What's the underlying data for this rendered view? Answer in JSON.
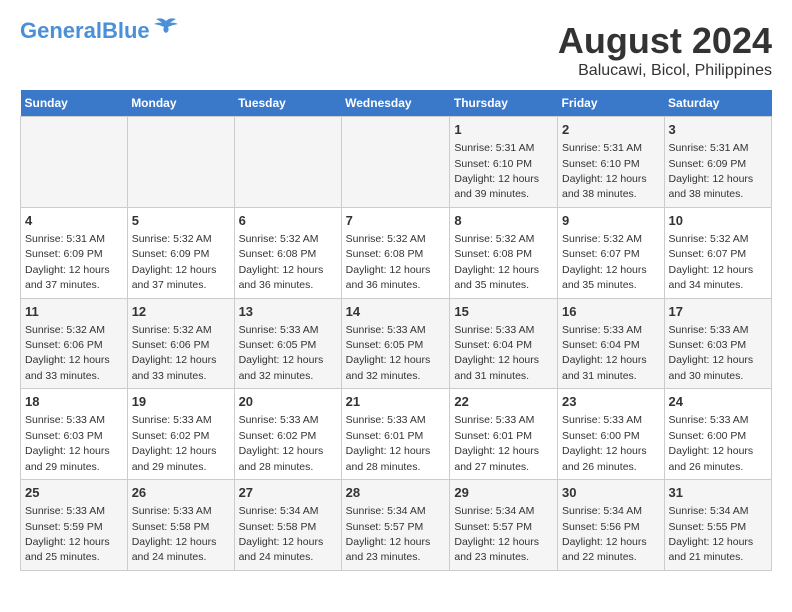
{
  "header": {
    "logo_general": "General",
    "logo_blue": "Blue",
    "title": "August 2024",
    "subtitle": "Balucawi, Bicol, Philippines"
  },
  "weekdays": [
    "Sunday",
    "Monday",
    "Tuesday",
    "Wednesday",
    "Thursday",
    "Friday",
    "Saturday"
  ],
  "weeks": [
    [
      {
        "day": "",
        "info": ""
      },
      {
        "day": "",
        "info": ""
      },
      {
        "day": "",
        "info": ""
      },
      {
        "day": "",
        "info": ""
      },
      {
        "day": "1",
        "info": "Sunrise: 5:31 AM\nSunset: 6:10 PM\nDaylight: 12 hours\nand 39 minutes."
      },
      {
        "day": "2",
        "info": "Sunrise: 5:31 AM\nSunset: 6:10 PM\nDaylight: 12 hours\nand 38 minutes."
      },
      {
        "day": "3",
        "info": "Sunrise: 5:31 AM\nSunset: 6:09 PM\nDaylight: 12 hours\nand 38 minutes."
      }
    ],
    [
      {
        "day": "4",
        "info": "Sunrise: 5:31 AM\nSunset: 6:09 PM\nDaylight: 12 hours\nand 37 minutes."
      },
      {
        "day": "5",
        "info": "Sunrise: 5:32 AM\nSunset: 6:09 PM\nDaylight: 12 hours\nand 37 minutes."
      },
      {
        "day": "6",
        "info": "Sunrise: 5:32 AM\nSunset: 6:08 PM\nDaylight: 12 hours\nand 36 minutes."
      },
      {
        "day": "7",
        "info": "Sunrise: 5:32 AM\nSunset: 6:08 PM\nDaylight: 12 hours\nand 36 minutes."
      },
      {
        "day": "8",
        "info": "Sunrise: 5:32 AM\nSunset: 6:08 PM\nDaylight: 12 hours\nand 35 minutes."
      },
      {
        "day": "9",
        "info": "Sunrise: 5:32 AM\nSunset: 6:07 PM\nDaylight: 12 hours\nand 35 minutes."
      },
      {
        "day": "10",
        "info": "Sunrise: 5:32 AM\nSunset: 6:07 PM\nDaylight: 12 hours\nand 34 minutes."
      }
    ],
    [
      {
        "day": "11",
        "info": "Sunrise: 5:32 AM\nSunset: 6:06 PM\nDaylight: 12 hours\nand 33 minutes."
      },
      {
        "day": "12",
        "info": "Sunrise: 5:32 AM\nSunset: 6:06 PM\nDaylight: 12 hours\nand 33 minutes."
      },
      {
        "day": "13",
        "info": "Sunrise: 5:33 AM\nSunset: 6:05 PM\nDaylight: 12 hours\nand 32 minutes."
      },
      {
        "day": "14",
        "info": "Sunrise: 5:33 AM\nSunset: 6:05 PM\nDaylight: 12 hours\nand 32 minutes."
      },
      {
        "day": "15",
        "info": "Sunrise: 5:33 AM\nSunset: 6:04 PM\nDaylight: 12 hours\nand 31 minutes."
      },
      {
        "day": "16",
        "info": "Sunrise: 5:33 AM\nSunset: 6:04 PM\nDaylight: 12 hours\nand 31 minutes."
      },
      {
        "day": "17",
        "info": "Sunrise: 5:33 AM\nSunset: 6:03 PM\nDaylight: 12 hours\nand 30 minutes."
      }
    ],
    [
      {
        "day": "18",
        "info": "Sunrise: 5:33 AM\nSunset: 6:03 PM\nDaylight: 12 hours\nand 29 minutes."
      },
      {
        "day": "19",
        "info": "Sunrise: 5:33 AM\nSunset: 6:02 PM\nDaylight: 12 hours\nand 29 minutes."
      },
      {
        "day": "20",
        "info": "Sunrise: 5:33 AM\nSunset: 6:02 PM\nDaylight: 12 hours\nand 28 minutes."
      },
      {
        "day": "21",
        "info": "Sunrise: 5:33 AM\nSunset: 6:01 PM\nDaylight: 12 hours\nand 28 minutes."
      },
      {
        "day": "22",
        "info": "Sunrise: 5:33 AM\nSunset: 6:01 PM\nDaylight: 12 hours\nand 27 minutes."
      },
      {
        "day": "23",
        "info": "Sunrise: 5:33 AM\nSunset: 6:00 PM\nDaylight: 12 hours\nand 26 minutes."
      },
      {
        "day": "24",
        "info": "Sunrise: 5:33 AM\nSunset: 6:00 PM\nDaylight: 12 hours\nand 26 minutes."
      }
    ],
    [
      {
        "day": "25",
        "info": "Sunrise: 5:33 AM\nSunset: 5:59 PM\nDaylight: 12 hours\nand 25 minutes."
      },
      {
        "day": "26",
        "info": "Sunrise: 5:33 AM\nSunset: 5:58 PM\nDaylight: 12 hours\nand 24 minutes."
      },
      {
        "day": "27",
        "info": "Sunrise: 5:34 AM\nSunset: 5:58 PM\nDaylight: 12 hours\nand 24 minutes."
      },
      {
        "day": "28",
        "info": "Sunrise: 5:34 AM\nSunset: 5:57 PM\nDaylight: 12 hours\nand 23 minutes."
      },
      {
        "day": "29",
        "info": "Sunrise: 5:34 AM\nSunset: 5:57 PM\nDaylight: 12 hours\nand 23 minutes."
      },
      {
        "day": "30",
        "info": "Sunrise: 5:34 AM\nSunset: 5:56 PM\nDaylight: 12 hours\nand 22 minutes."
      },
      {
        "day": "31",
        "info": "Sunrise: 5:34 AM\nSunset: 5:55 PM\nDaylight: 12 hours\nand 21 minutes."
      }
    ]
  ]
}
